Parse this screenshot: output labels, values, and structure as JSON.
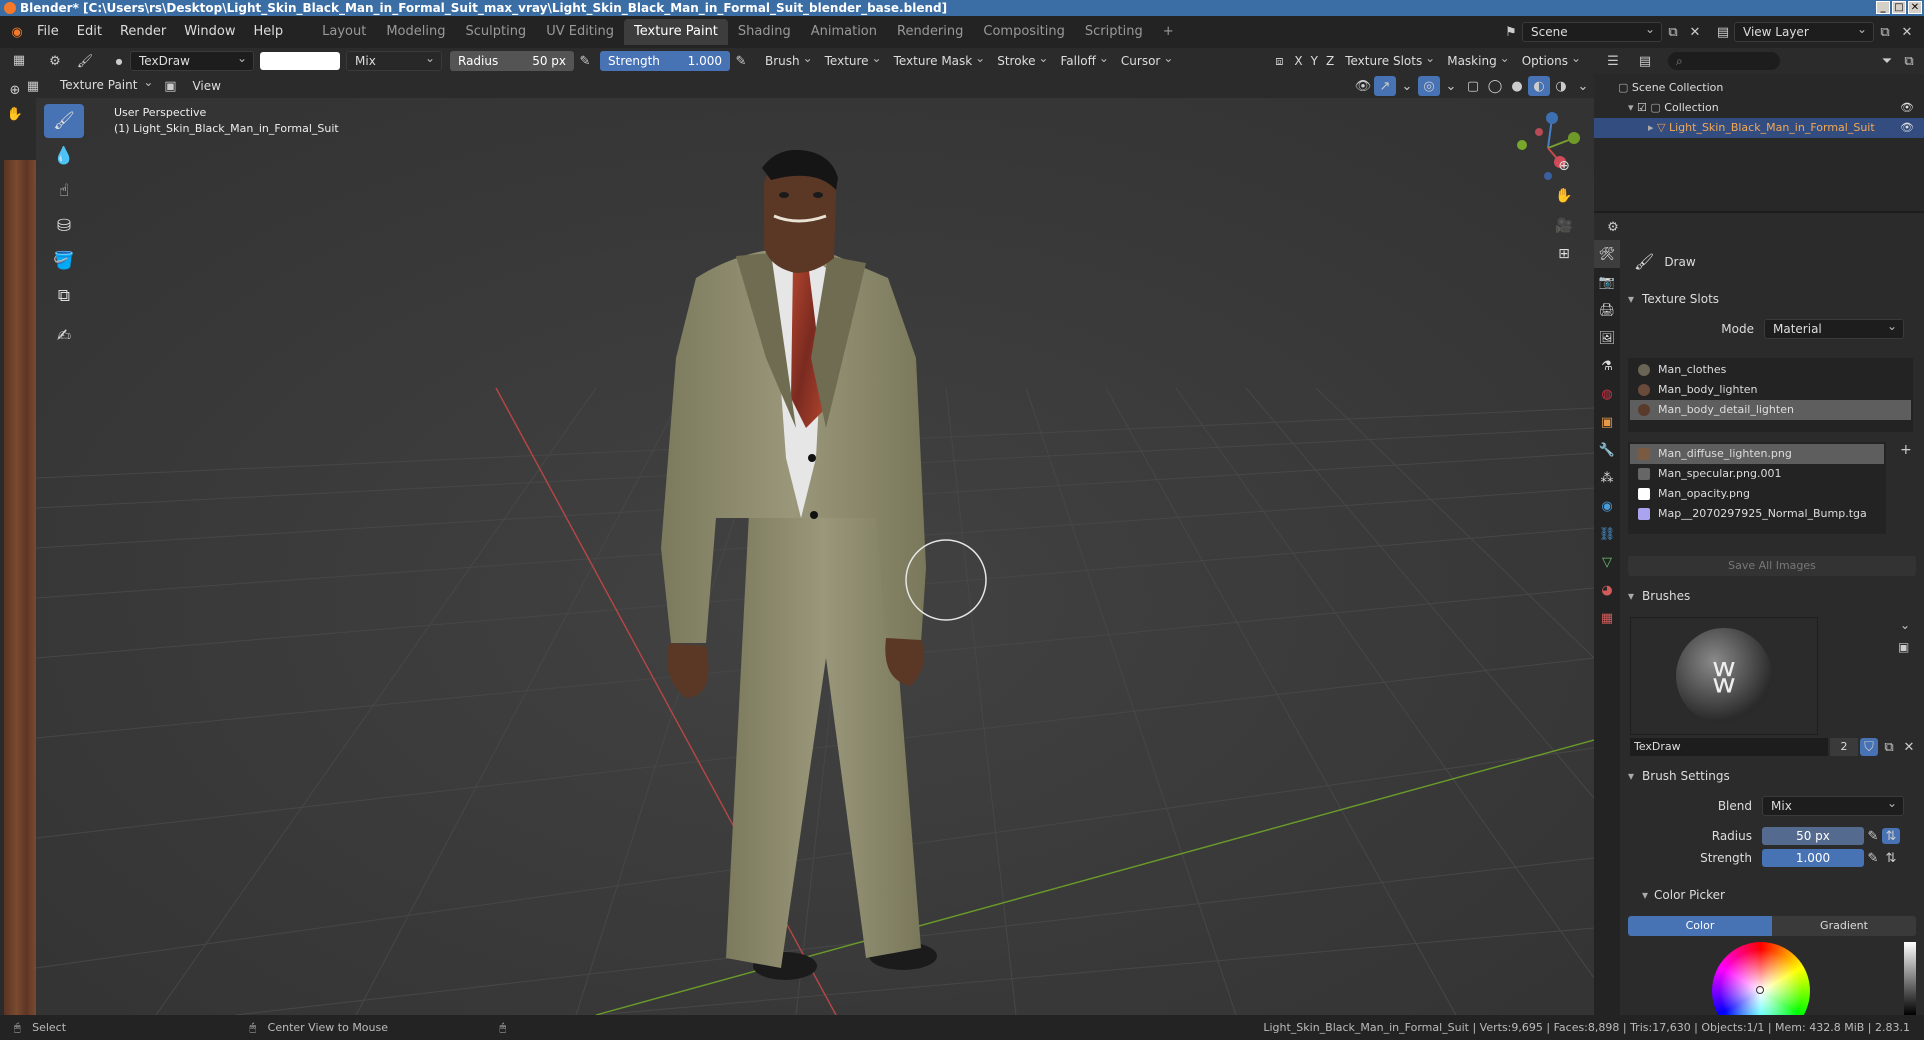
{
  "window": {
    "title": "Blender* [C:\\Users\\rs\\Desktop\\Light_Skin_Black_Man_in_Formal_Suit_max_vray\\Light_Skin_Black_Man_in_Formal_Suit_blender_base.blend]"
  },
  "menu": [
    "File",
    "Edit",
    "Render",
    "Window",
    "Help"
  ],
  "workspaces": [
    "Layout",
    "Modeling",
    "Sculpting",
    "UV Editing",
    "Texture Paint",
    "Shading",
    "Animation",
    "Rendering",
    "Compositing",
    "Scripting"
  ],
  "active_workspace": "Texture Paint",
  "scene": {
    "label": "Scene",
    "view_layer": "View Layer"
  },
  "tool_header": {
    "brush_name": "TexDraw",
    "blend": "Mix",
    "radius_label": "Radius",
    "radius_value": "50 px",
    "strength_label": "Strength",
    "strength_value": "1.000",
    "menus": [
      "Brush",
      "Texture",
      "Texture Mask",
      "Stroke",
      "Falloff",
      "Cursor"
    ],
    "texture_slots": "Texture Slots",
    "masking": "Masking",
    "options": "Options",
    "axes": [
      "X",
      "Y",
      "Z"
    ]
  },
  "viewport_header": {
    "mode": "Texture Paint",
    "view": "View"
  },
  "viewport": {
    "line1": "User Perspective",
    "line2": "(1) Light_Skin_Black_Man_in_Formal_Suit"
  },
  "outliner": {
    "root": "Scene Collection",
    "collection": "Collection",
    "object": "Light_Skin_Black_Man_in_Formal_Suit"
  },
  "properties": {
    "tool_name": "Draw",
    "texture_slots": {
      "title": "Texture Slots",
      "mode_label": "Mode",
      "mode_value": "Material",
      "materials": [
        "Man_clothes",
        "Man_body_lighten",
        "Man_body_detail_lighten"
      ],
      "images": [
        "Man_diffuse_lighten.png",
        "Man_specular.png.001",
        "Man_opacity.png",
        "Map__2070297925_Normal_Bump.tga"
      ],
      "save_all": "Save All Images"
    },
    "brushes": {
      "title": "Brushes",
      "name": "TexDraw",
      "users": "2"
    },
    "brush_settings": {
      "title": "Brush Settings",
      "blend_label": "Blend",
      "blend_value": "Mix",
      "radius_label": "Radius",
      "radius_value": "50 px",
      "strength_label": "Strength",
      "strength_value": "1.000"
    },
    "color_picker": {
      "title": "Color Picker",
      "tabs": [
        "Color",
        "Gradient"
      ]
    }
  },
  "status": {
    "select": "Select",
    "center": "Center View to Mouse",
    "stats": "Light_Skin_Black_Man_in_Formal_Suit | Verts:9,695 | Faces:8,898 | Tris:17,630 | Objects:1/1 | Mem: 432.8 MiB | 2.83.1"
  },
  "colors": {
    "accent": "#4772b3",
    "viewport_bg": "#393939",
    "header": "#2b2b2b",
    "suit": "#8d8a68",
    "tie": "#9a3a2c"
  }
}
